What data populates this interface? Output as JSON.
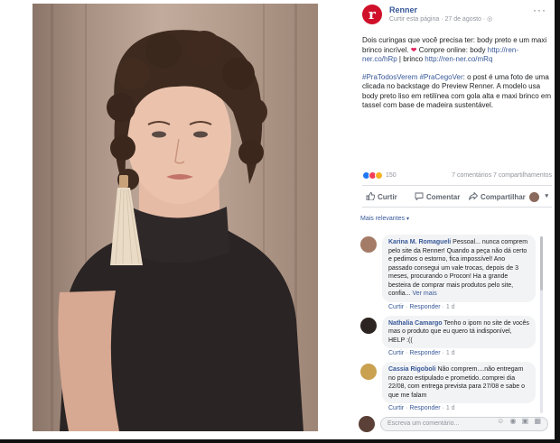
{
  "post": {
    "page_name": "Renner",
    "logo_letter": "r",
    "meta": "Curtir esta página · 27 de agosto · ",
    "more": "···",
    "text1_a": "Dois curingas que você precisa ter: body preto e um maxi brinco incrível. ",
    "text1_b": " Compre online: body ",
    "link1": "http://ren-ner.co/hRp",
    "text1_c": " | brinco ",
    "link2": "http://ren-ner.co/mRq",
    "hashtags": "#PraTodosVerem #PraCegoVer",
    "text2": ": o post é uma foto de uma clicada no backstage do Preview Renner. A modelo usa body preto liso em retilínea com gola alta e maxi brinco em tassel com base de madeira sustentável.",
    "reactions_count": "150",
    "comments_shares": "7 comentários  7 compartilhamentos",
    "actions": {
      "like": "Curtir",
      "comment": "Comentar",
      "share": "Compartilhar"
    },
    "more_relevant": "Mais relevantes"
  },
  "comments": [
    {
      "name": "Karina M. Romagueli",
      "text": " Pessoal... nunca comprem pelo site da Renner! Quando a peça não dá certo e pedimos o estorno, fica impossível! Ano passado consegui um vale trocas, depois de 3 meses, procurando o Procon! Ha a grande besteira de comprar mais produtos pelo site, confia...",
      "see_more": " Ver mais",
      "like": "Curtir",
      "reply": "Responder",
      "time": "1 d"
    },
    {
      "name": "Nathalia Camargo",
      "text": " Tenho o ipom no site de vocês mas o produto que eu quero tá indisponível, HELP :((",
      "like": "Curtir",
      "reply": "Responder",
      "time": "1 d"
    },
    {
      "name": "Cassia Rigoboli",
      "text": " Não comprem....não entregam no prazo estipulado e prometido..comprei dia 22/08, com entrega prevista para 27/08 e sabe o que me falam",
      "like": "Curtir",
      "reply": "Responder",
      "time": "1 d"
    }
  ],
  "composer": {
    "placeholder": "Escreva um comentário...",
    "icons": "☺ ◉ ▣ ▦"
  },
  "colors": {
    "brand": "#d0102a",
    "link": "#385898",
    "like": "#2078f4",
    "love": "#f33e58"
  }
}
